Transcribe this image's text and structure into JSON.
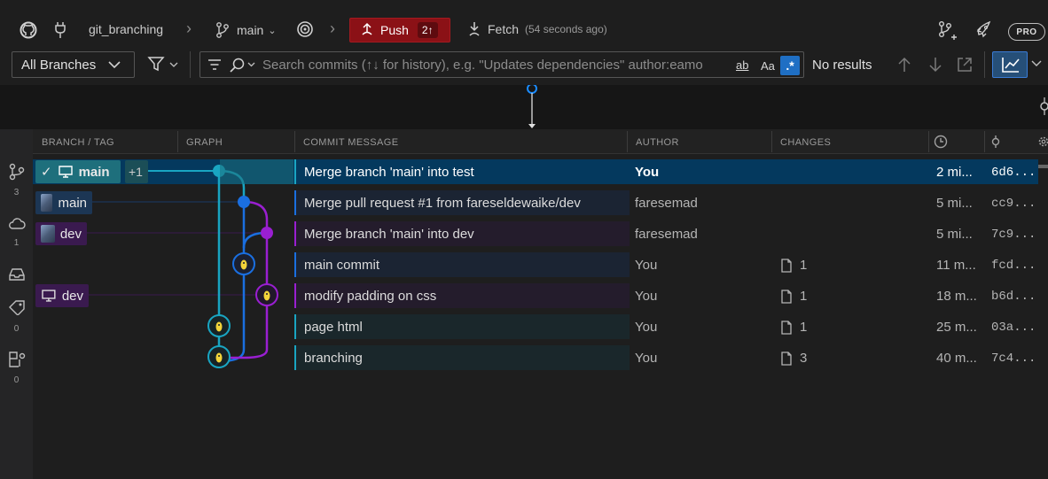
{
  "toolbar": {
    "repo_name": "git_branching",
    "branch_name": "main",
    "push_label": "Push",
    "push_count": "2↑",
    "fetch_label": "Fetch",
    "fetch_time": "(54 seconds ago)",
    "pro_label": "PRO"
  },
  "filters": {
    "branch_filter": "All Branches",
    "search_placeholder": "Search commits (↑↓ for history), e.g. \"Updates dependencies\" author:eamo",
    "match_word_label": "ab",
    "match_case_label": "Aa",
    "regex_label": ".*",
    "results_label": "No results"
  },
  "rail": {
    "branches_count": "3",
    "remotes_count": "1",
    "stashes_count": "",
    "tags_count": "0",
    "worktrees_count": "0"
  },
  "columns": {
    "branch_tag": "BRANCH / TAG",
    "graph": "GRAPH",
    "commit_message": "COMMIT MESSAGE",
    "author": "AUTHOR",
    "changes": "CHANGES"
  },
  "commits": [
    {
      "branch_label": "main",
      "extra_refs": "+1",
      "message": "Merge branch 'main' into test",
      "author": "You",
      "changes": "",
      "time": "2 mi...",
      "sha": "6d6..."
    },
    {
      "branch_label": "main",
      "message": "Merge pull request #1 from fareseldewaike/dev",
      "author": "faresemad",
      "changes": "",
      "time": "5 mi...",
      "sha": "cc9..."
    },
    {
      "branch_label": "dev",
      "message": "Merge branch 'main' into dev",
      "author": "faresemad",
      "changes": "",
      "time": "5 mi...",
      "sha": "7c9..."
    },
    {
      "branch_label": "",
      "message": "main commit",
      "author": "You",
      "changes": "1",
      "time": "11 m...",
      "sha": "fcd..."
    },
    {
      "branch_label": "dev",
      "message": "modify padding on css",
      "author": "You",
      "changes": "1",
      "time": "18 m...",
      "sha": "b6d..."
    },
    {
      "branch_label": "",
      "message": "page html",
      "author": "You",
      "changes": "1",
      "time": "25 m...",
      "sha": "03a..."
    },
    {
      "branch_label": "",
      "message": "branching",
      "author": "You",
      "changes": "3",
      "time": "40 m...",
      "sha": "7c4..."
    }
  ],
  "colors": {
    "lane_test": "#19a5c2",
    "lane_main": "#1a6fe0",
    "lane_dev": "#9a1fd1",
    "push_bg": "#8b1116",
    "selected_row": "#04395e"
  }
}
